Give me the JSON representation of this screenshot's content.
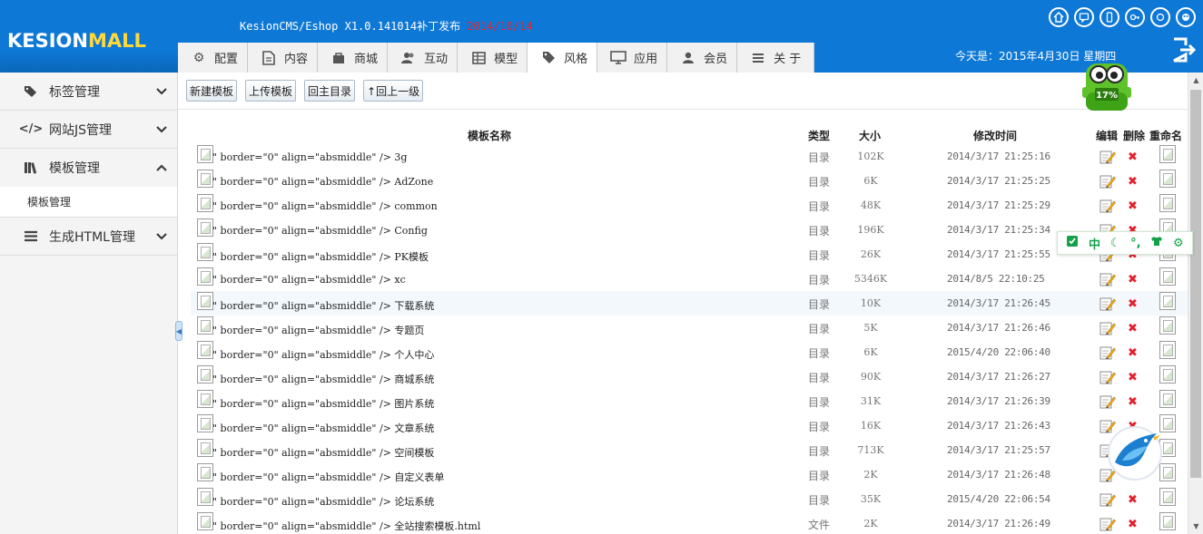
{
  "header": {
    "logo_main": "KESION",
    "logo_accent": "MALL",
    "version": "KesionCMS/Eshop X1.0.141014补丁发布",
    "release_date": "2014/10/14",
    "today": "今天是：2015年4月30日 星期四"
  },
  "tabs": [
    {
      "label": "配置",
      "icon": "gear-icon"
    },
    {
      "label": "内容",
      "icon": "document-icon"
    },
    {
      "label": "商城",
      "icon": "bag-icon"
    },
    {
      "label": "互动",
      "icon": "users-icon"
    },
    {
      "label": "模型",
      "icon": "grid-icon"
    },
    {
      "label": "风格",
      "icon": "tag-icon"
    },
    {
      "label": "应用",
      "icon": "monitor-icon"
    },
    {
      "label": "会员",
      "icon": "user-icon"
    },
    {
      "label": "关 于",
      "icon": "menu-icon"
    }
  ],
  "active_tab": "风格",
  "sidebar": {
    "items": [
      {
        "label": "标签管理",
        "icon": "tag-icon"
      },
      {
        "label": "网站JS管理",
        "icon": "code-icon"
      },
      {
        "label": "模板管理",
        "icon": "books-icon"
      },
      {
        "label": "生成HTML管理",
        "icon": "list-icon"
      }
    ],
    "sub_item": "模板管理"
  },
  "toolbar": {
    "new_template": "新建模板",
    "upload_template": "上传模板",
    "back_root": "回主目录",
    "up_level": "↑回上一级"
  },
  "table": {
    "headers": {
      "name": "模板名称",
      "type": "类型",
      "size": "大小",
      "time": "修改时间",
      "edit": "编辑",
      "delete": "删除",
      "rename": "重命名"
    },
    "rows": [
      {
        "name": "\" border=\"0\" align=\"absmiddle\" /> 3g",
        "type": "目录",
        "size": "102K",
        "time": "2014/3/17 21:25:16"
      },
      {
        "name": "\" border=\"0\" align=\"absmiddle\" /> AdZone",
        "type": "目录",
        "size": "6K",
        "time": "2014/3/17 21:25:25"
      },
      {
        "name": "\" border=\"0\" align=\"absmiddle\" /> common",
        "type": "目录",
        "size": "48K",
        "time": "2014/3/17 21:25:29"
      },
      {
        "name": "\" border=\"0\" align=\"absmiddle\" /> Config",
        "type": "目录",
        "size": "196K",
        "time": "2014/3/17 21:25:34"
      },
      {
        "name": "\" border=\"0\" align=\"absmiddle\" /> PK模板",
        "type": "目录",
        "size": "26K",
        "time": "2014/3/17 21:25:55"
      },
      {
        "name": "\" border=\"0\" align=\"absmiddle\" /> xc",
        "type": "目录",
        "size": "5346K",
        "time": "2014/8/5 22:10:25"
      },
      {
        "name": "\" border=\"0\" align=\"absmiddle\" /> 下载系统",
        "type": "目录",
        "size": "10K",
        "time": "2014/3/17 21:26:45"
      },
      {
        "name": "\" border=\"0\" align=\"absmiddle\" /> 专题页",
        "type": "目录",
        "size": "5K",
        "time": "2014/3/17 21:26:46"
      },
      {
        "name": "\" border=\"0\" align=\"absmiddle\" /> 个人中心",
        "type": "目录",
        "size": "6K",
        "time": "2015/4/20 22:06:40"
      },
      {
        "name": "\" border=\"0\" align=\"absmiddle\" /> 商城系统",
        "type": "目录",
        "size": "90K",
        "time": "2014/3/17 21:26:27"
      },
      {
        "name": "\" border=\"0\" align=\"absmiddle\" /> 图片系统",
        "type": "目录",
        "size": "31K",
        "time": "2014/3/17 21:26:39"
      },
      {
        "name": "\" border=\"0\" align=\"absmiddle\" /> 文章系统",
        "type": "目录",
        "size": "16K",
        "time": "2014/3/17 21:26:43"
      },
      {
        "name": "\" border=\"0\" align=\"absmiddle\" /> 空间模板",
        "type": "目录",
        "size": "713K",
        "time": "2014/3/17 21:25:57"
      },
      {
        "name": "\" border=\"0\" align=\"absmiddle\" /> 自定义表单",
        "type": "目录",
        "size": "2K",
        "time": "2014/3/17 21:26:48"
      },
      {
        "name": "\" border=\"0\" align=\"absmiddle\" /> 论坛系统",
        "type": "目录",
        "size": "35K",
        "time": "2015/4/20 22:06:54"
      },
      {
        "name": "\" border=\"0\" align=\"absmiddle\" /> 全站搜索模板.html",
        "type": "文件",
        "size": "2K",
        "time": "2014/3/17 21:26:49"
      }
    ],
    "delete_glyph": "✖"
  },
  "widgets": {
    "mascot_percent": "17%",
    "ime_mode": "中"
  },
  "colors": {
    "header_bg": "#0e78d6",
    "release_date": "#e8232b",
    "logo_accent": "#ffd93a",
    "delete_red": "#e2202b",
    "ime_green": "#13a24a"
  }
}
